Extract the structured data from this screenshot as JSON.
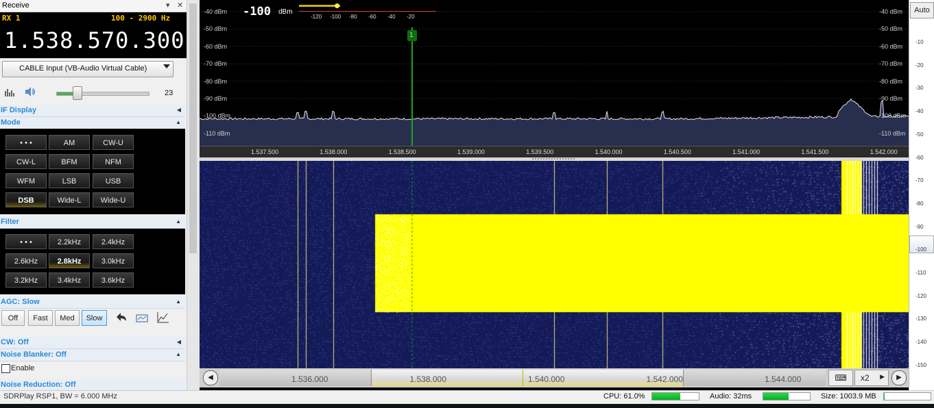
{
  "window": {
    "title": "Receive"
  },
  "receiver": {
    "label": "RX 1",
    "bandwidth": "100 - 2900 Hz",
    "frequency": "1.538.570.300"
  },
  "audio": {
    "device": "CABLE Input (VB-Audio Virtual Cable)",
    "volume": "23",
    "volume_level": 0.2
  },
  "sections": {
    "if_display": "IF Display",
    "mode": "Mode",
    "filter": "Filter",
    "agc": "AGC: Slow",
    "cw": "CW: Off",
    "noise_blanker": "Noise Blanker: Off",
    "noise_reduction": "Noise Reduction: Off"
  },
  "modes": [
    "• • •",
    "AM",
    "CW-U",
    "CW-L",
    "BFM",
    "NFM",
    "WFM",
    "LSB",
    "USB",
    "DSB",
    "Wide-L",
    "Wide-U"
  ],
  "mode_selected": "DSB",
  "filters": [
    "• • •",
    "2.2kHz",
    "2.4kHz",
    "2.6kHz",
    "2.8kHz",
    "3.0kHz",
    "3.2kHz",
    "3.4kHz",
    "3.6kHz"
  ],
  "filter_selected": "2.8kHz",
  "agc_buttons": [
    "Off",
    "Fast",
    "Med",
    "Slow"
  ],
  "agc_selected": "Slow",
  "nb": {
    "enable_label": "Enable"
  },
  "spectrum": {
    "level_value": "-100",
    "level_unit": "dBm",
    "level_scale": [
      "-120",
      "-100",
      "-80",
      "-60",
      "-40",
      "-20"
    ],
    "dbm_labels": [
      "-40 dBm",
      "-50 dBm",
      "-60 dBm",
      "-70 dBm",
      "-80 dBm",
      "-90 dBm",
      "-100 dBm",
      "-110 dBm"
    ],
    "freq_labels": [
      "1.537.500",
      "1.538.000",
      "1.538.500",
      "1.539.000",
      "1.539.500",
      "1.540.000",
      "1.540.500",
      "1.541.000",
      "1.541.500",
      "1.542.000"
    ],
    "marker_label": "1"
  },
  "overview": {
    "freq_labels": [
      "1.536.000",
      "1.538.000",
      "1.540.000",
      "1.542.000",
      "1.544.000"
    ],
    "zoom": "x2"
  },
  "right_scale": {
    "auto_label": "Auto",
    "ticks": [
      "-10",
      "-20",
      "-30",
      "-40",
      "-50",
      "-60",
      "-70",
      "-80",
      "-90",
      "-100",
      "-110",
      "-120",
      "-130",
      "-140",
      "-150"
    ]
  },
  "status": {
    "device": "SDRPlay RSP1, BW = 6.000 MHz",
    "cpu_label": "CPU: 61.0%",
    "cpu_level": 0.61,
    "audio_label": "Audio: 32ms",
    "audio_level": 0.55,
    "size_label": "Size: 1003.9 MB",
    "size_level": 0.02
  },
  "colors": {
    "accent": "#2a8ad4",
    "rx_text": "#ffc800",
    "waterfall_signal": "#ffff00",
    "waterfall_bg": "#1a1f5a"
  }
}
